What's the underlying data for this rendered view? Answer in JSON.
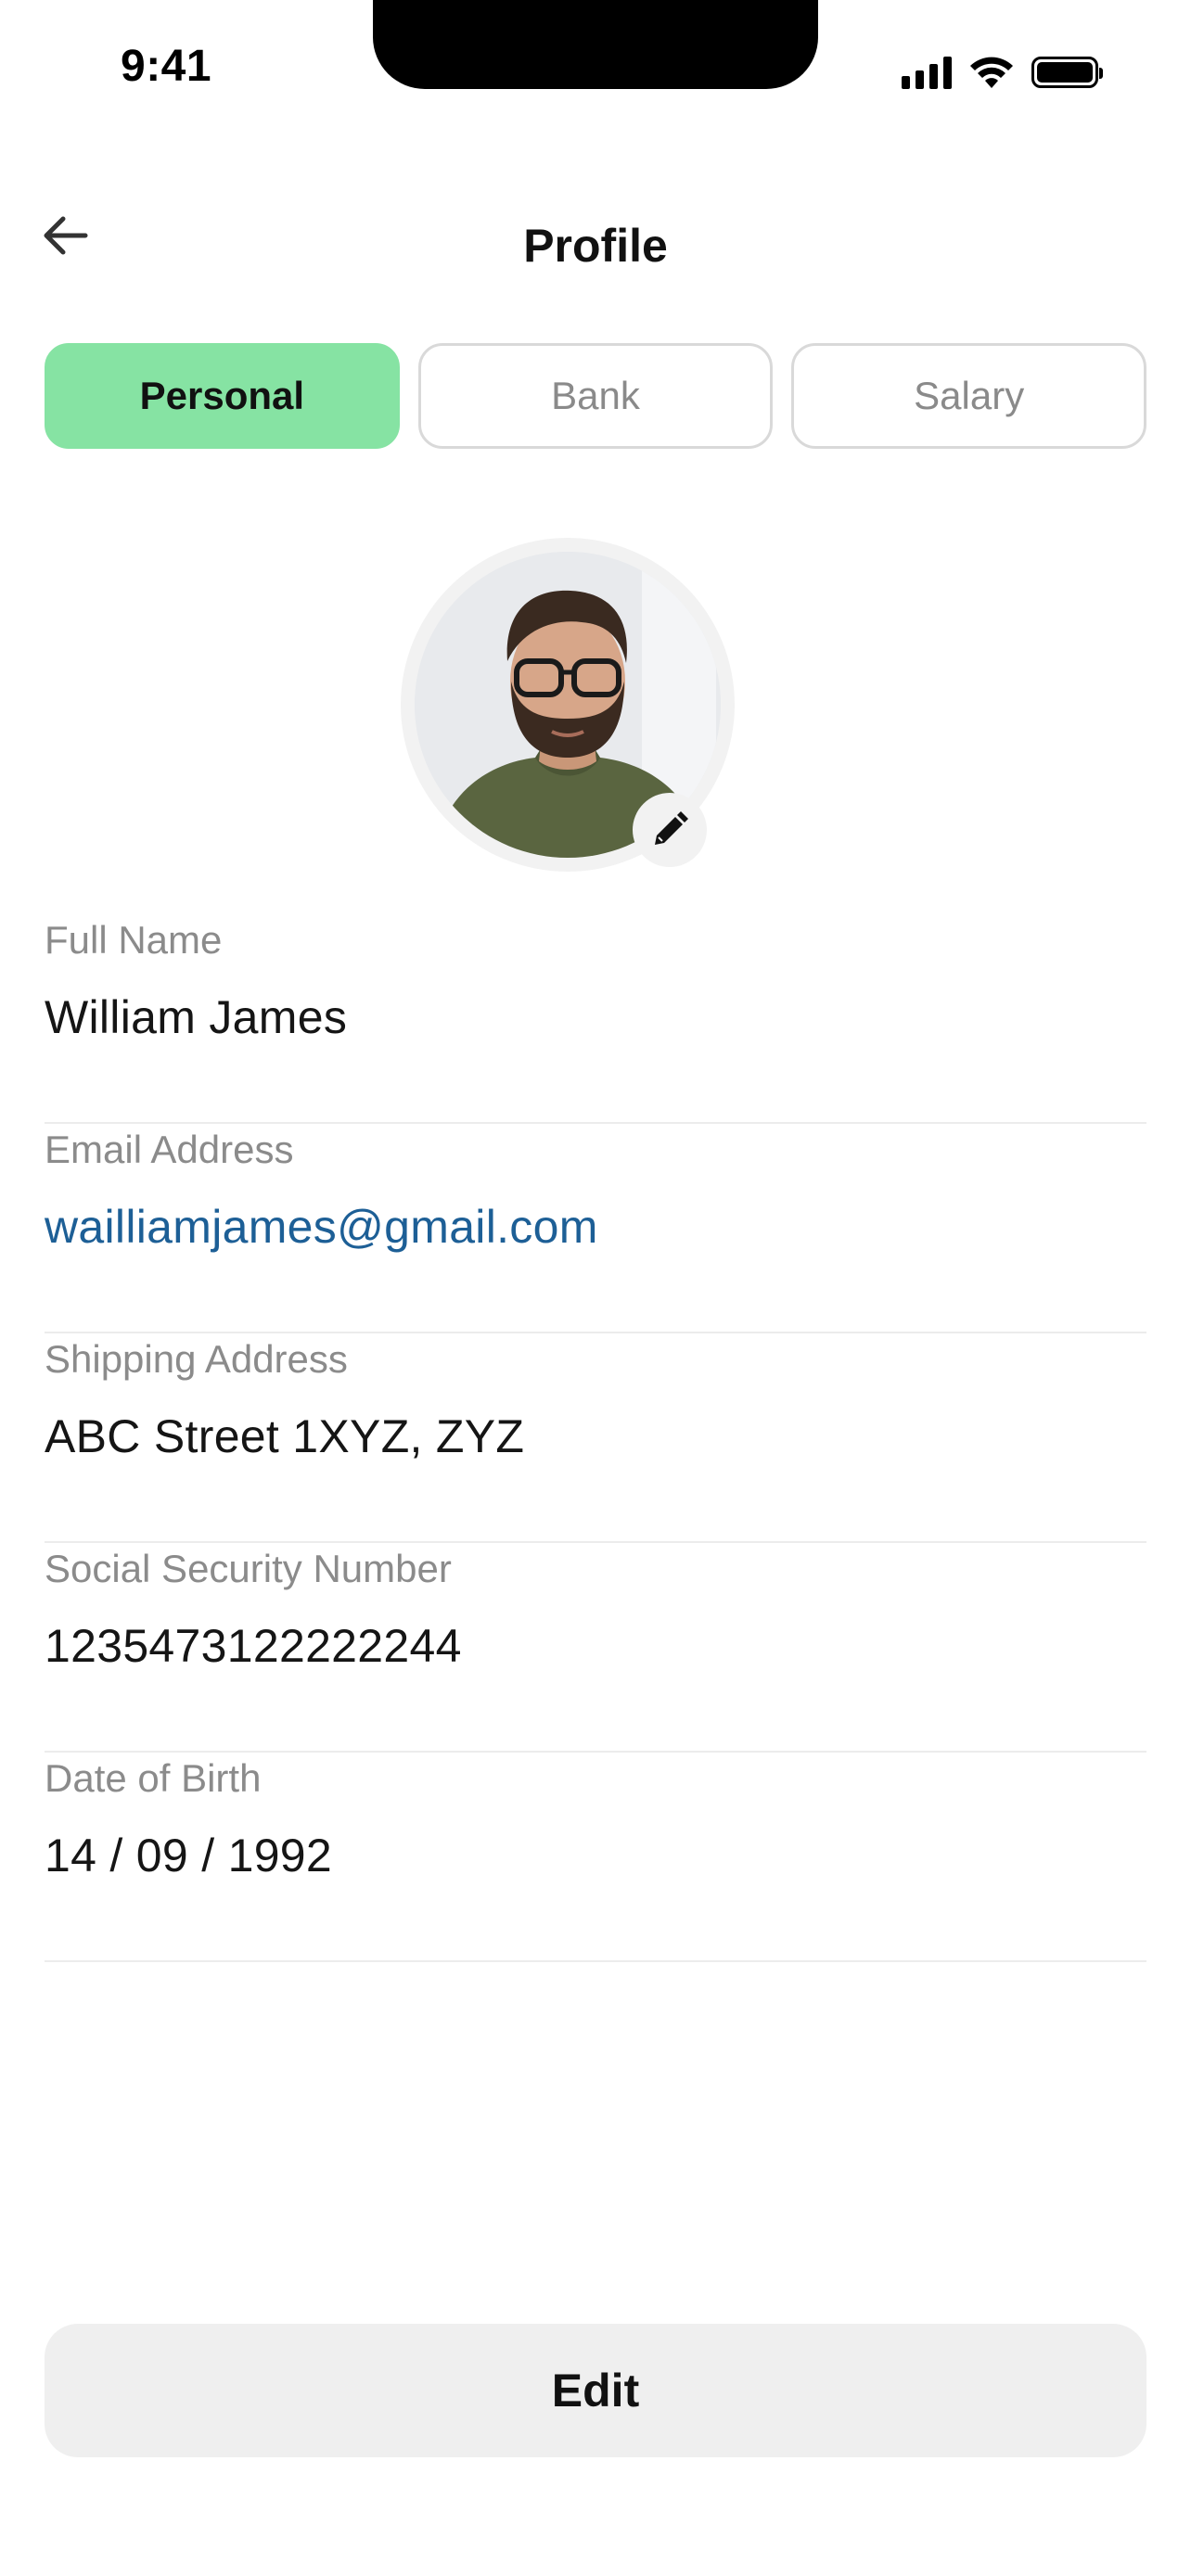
{
  "status_bar": {
    "time": "9:41"
  },
  "header": {
    "title": "Profile",
    "back_icon": "arrow-left-icon"
  },
  "tabs": [
    {
      "label": "Personal",
      "active": true
    },
    {
      "label": "Bank",
      "active": false
    },
    {
      "label": "Salary",
      "active": false
    }
  ],
  "avatar": {
    "edit_icon": "pencil-icon"
  },
  "fields": {
    "full_name": {
      "label": "Full Name",
      "value": "William James"
    },
    "email": {
      "label": "Email Address",
      "value": "wailliamjames@gmail.com"
    },
    "shipping": {
      "label": "Shipping Address",
      "value": "ABC Street 1XYZ, ZYZ"
    },
    "ssn": {
      "label": "Social Security Number",
      "value": "1235473122222244"
    },
    "dob": {
      "label": "Date of Birth",
      "value": "14 / 09 / 1992"
    }
  },
  "actions": {
    "edit_label": "Edit"
  },
  "colors": {
    "active_tab": "#86e3a3",
    "link": "#1d5f96",
    "button_bg": "#efefef"
  }
}
